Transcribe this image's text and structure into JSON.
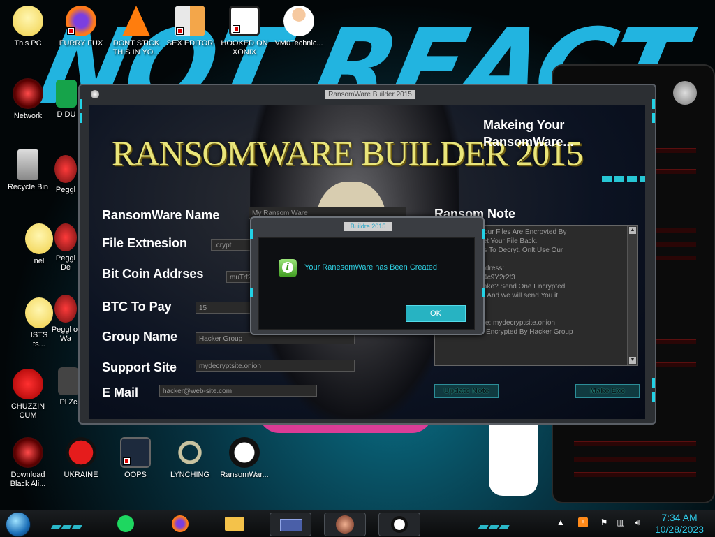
{
  "desktop": {
    "icons": [
      {
        "id": "this-pc",
        "label": "This PC"
      },
      {
        "id": "furry-fux",
        "label": "FURRY FUX"
      },
      {
        "id": "dont-stick",
        "label": "DONT STICK THIS IN YO..."
      },
      {
        "id": "sex-editor",
        "label": "SEX EDITOR"
      },
      {
        "id": "hooked-on-xonix",
        "label": "HOOKED ON XONIX"
      },
      {
        "id": "vm0technic",
        "label": "VM0Technic..."
      },
      {
        "id": "network",
        "label": "Network"
      },
      {
        "id": "recycle-bin",
        "label": "Recycle Bin"
      },
      {
        "id": "chuzzin-cum",
        "label": "CHUZZIN CUM"
      },
      {
        "id": "download-black-ali",
        "label": "Download Black Ali..."
      },
      {
        "id": "ukraine",
        "label": "UKRAINE"
      },
      {
        "id": "oops",
        "label": "OOPS"
      },
      {
        "id": "lynching",
        "label": "LYNCHING"
      },
      {
        "id": "ransomwar",
        "label": "RansomWar..."
      },
      {
        "id": "peggle-1",
        "label": "Peggl"
      },
      {
        "id": "peggle-2",
        "label": "Peggl De"
      },
      {
        "id": "peggle-3",
        "label": "Peggl of Wa"
      },
      {
        "id": "partial-d",
        "label": "D DU"
      },
      {
        "id": "partial-nel",
        "label": "nel"
      },
      {
        "id": "partial-ists",
        "label": "ISTS ts..."
      },
      {
        "id": "partial-pl",
        "label": "Pl Zc"
      }
    ]
  },
  "main_window": {
    "title": "RansomWare Builder 2015",
    "logo_text": "RANSOMWARE BUILDER 2015",
    "status_heading": "Makeing Your RansomWare...",
    "fields": {
      "name": {
        "label": "RansomWare Name",
        "value": "My Ransom Ware"
      },
      "extension": {
        "label": "File Extnesion",
        "value": ".crypt"
      },
      "btc_address": {
        "label": "Bit Coin Addrses",
        "value": "muTrf2v"
      },
      "btc_to_pay": {
        "label": "BTC To Pay",
        "value": "15"
      },
      "group_name": {
        "label": "Group Name",
        "value": "Hacker Group"
      },
      "support_site": {
        "label": "Support Site",
        "value": "mydecryptsite.onion"
      },
      "email": {
        "label": "E Mail",
        "value": "hacker@web-site.com"
      }
    },
    "note": {
      "label": "Ransom Note",
      "text": "So Sorry. But Your Files Are Encrpyted By\nrry! You Can Get Your File Back.\nUse Other Tools To Decryt. Onlt Use Our\n\nOur Bit Coin Address:\nopS9TY4fEioU4c9Y2r2f3\nous We Aere Fake? Send One Encrypted\n@web-site.com And we will send You it\n\n\nOur Support Site: mydecryptsite.onion\nYou Files Were Encrypted By Hacker Group"
    },
    "buttons": {
      "update_note": "Update Note",
      "make_exe": "Make Exe"
    }
  },
  "dialog": {
    "title": "Buildre 2015",
    "message": "Your RanesomWare has Been Created!",
    "ok_label": "OK"
  },
  "taskbar": {
    "time": "7:34 AM",
    "date": "10/28/2023",
    "apps": [
      "spotify",
      "firefox",
      "file-explorer",
      "card-app",
      "avatar-app",
      "skull-app"
    ]
  },
  "colors": {
    "accent": "#27c6d4",
    "logo": "#e9e57a",
    "dialog_text": "#2fd1e3",
    "clock": "#2fc9e6"
  }
}
